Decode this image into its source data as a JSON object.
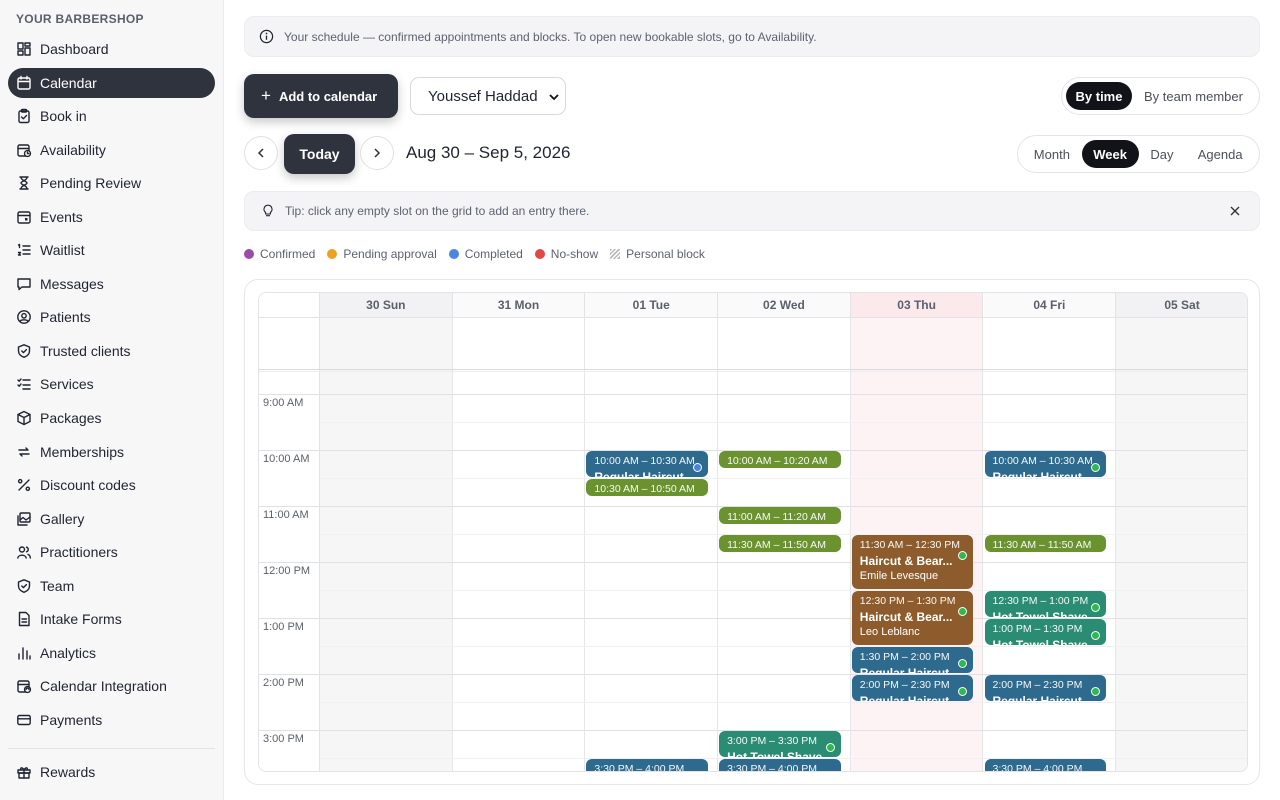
{
  "sidebar": {
    "brand": "YOUR BARBERSHOP",
    "items": [
      {
        "label": "Dashboard",
        "icon": "dashboard-icon"
      },
      {
        "label": "Calendar",
        "icon": "calendar-icon"
      },
      {
        "label": "Book in",
        "icon": "clipboard-icon"
      },
      {
        "label": "Availability",
        "icon": "calendar-clock-icon"
      },
      {
        "label": "Pending Review",
        "icon": "hourglass-icon"
      },
      {
        "label": "Events",
        "icon": "calendar-event-icon"
      },
      {
        "label": "Waitlist",
        "icon": "list-ordered-icon"
      },
      {
        "label": "Messages",
        "icon": "message-icon"
      },
      {
        "label": "Patients",
        "icon": "user-circle-icon"
      },
      {
        "label": "Trusted clients",
        "icon": "shield-check-icon"
      },
      {
        "label": "Services",
        "icon": "checklist-icon"
      },
      {
        "label": "Packages",
        "icon": "package-icon"
      },
      {
        "label": "Memberships",
        "icon": "repeat-icon"
      },
      {
        "label": "Discount codes",
        "icon": "percent-icon"
      },
      {
        "label": "Gallery",
        "icon": "gallery-icon"
      },
      {
        "label": "Practitioners",
        "icon": "users-icon"
      },
      {
        "label": "Team",
        "icon": "shield-icon"
      },
      {
        "label": "Intake Forms",
        "icon": "document-icon"
      },
      {
        "label": "Analytics",
        "icon": "bar-chart-icon"
      },
      {
        "label": "Calendar Integration",
        "icon": "calendar-sync-icon"
      },
      {
        "label": "Payments",
        "icon": "credit-card-icon"
      }
    ],
    "active_index": 1,
    "bottom_items": [
      {
        "label": "Rewards",
        "icon": "gift-icon"
      }
    ]
  },
  "banner": {
    "text": "Your schedule — confirmed appointments and blocks. To open new bookable slots, go to Availability."
  },
  "toolbar": {
    "add_label": "Add to calendar",
    "member_select": "Youssef Haddad",
    "view_mode": [
      "By time",
      "By team member"
    ],
    "view_mode_selected": "By time",
    "today_label": "Today",
    "date_range": "Aug 30 – Sep 5, 2026",
    "range_modes": [
      "Month",
      "Week",
      "Day",
      "Agenda"
    ],
    "range_mode_selected": "Week"
  },
  "tip": {
    "text": "Tip: click any empty slot on the grid to add an entry there."
  },
  "legend": [
    {
      "label": "Confirmed",
      "color": "#9b4ba8",
      "kind": "dot"
    },
    {
      "label": "Pending approval",
      "color": "#f0a020",
      "kind": "dot"
    },
    {
      "label": "Completed",
      "color": "#4a86e0",
      "kind": "dot"
    },
    {
      "label": "No-show",
      "color": "#e04848",
      "kind": "dot"
    },
    {
      "label": "Personal block",
      "color": "#b8b8be",
      "kind": "hatch"
    }
  ],
  "calendar": {
    "days": [
      "30 Sun",
      "31 Mon",
      "01 Tue",
      "02 Wed",
      "03 Thu",
      "04 Fri",
      "05 Sat"
    ],
    "today_index": 4,
    "times": [
      "9:00 AM",
      "10:00 AM",
      "11:00 AM",
      "12:00 PM",
      "1:00 PM",
      "2:00 PM",
      "3:00 PM"
    ],
    "colors": {
      "blue": "#2d6a8e",
      "olive": "#6a922e",
      "brown": "#8e5c2c",
      "teal": "#2b8c74"
    },
    "events": [
      {
        "day": 2,
        "start": 10.0,
        "end": 10.5,
        "time": "10:00 AM – 10:30 AM",
        "title": "Regular Haircut",
        "client": "",
        "color": "blue",
        "status": "#4a86e0"
      },
      {
        "day": 2,
        "start": 10.5,
        "end": 10.8333,
        "time": "10:30 AM – 10:50 AM",
        "title": "",
        "client": "",
        "color": "olive",
        "status": ""
      },
      {
        "day": 3,
        "start": 10.0,
        "end": 10.3333,
        "time": "10:00 AM – 10:20 AM",
        "title": "",
        "client": "",
        "color": "olive",
        "status": ""
      },
      {
        "day": 3,
        "start": 11.0,
        "end": 11.3333,
        "time": "11:00 AM – 11:20 AM",
        "title": "",
        "client": "",
        "color": "olive",
        "status": ""
      },
      {
        "day": 3,
        "start": 11.5,
        "end": 11.8333,
        "time": "11:30 AM – 11:50 AM",
        "title": "",
        "client": "",
        "color": "olive",
        "status": ""
      },
      {
        "day": 4,
        "start": 11.5,
        "end": 12.5,
        "time": "11:30 AM – 12:30 PM",
        "title": "Haircut & Bear...",
        "client": "Emile Levesque",
        "color": "brown",
        "status": "#2fb84e"
      },
      {
        "day": 4,
        "start": 12.5,
        "end": 13.5,
        "time": "12:30 PM – 1:30 PM",
        "title": "Haircut & Bear...",
        "client": "Leo Leblanc",
        "color": "brown",
        "status": "#2fb84e"
      },
      {
        "day": 4,
        "start": 13.5,
        "end": 14.0,
        "time": "1:30 PM – 2:00 PM",
        "title": "Regular Haircut",
        "client": "",
        "color": "blue",
        "status": "#2fb84e"
      },
      {
        "day": 4,
        "start": 14.0,
        "end": 14.5,
        "time": "2:00 PM – 2:30 PM",
        "title": "Regular Haircut",
        "client": "",
        "color": "blue",
        "status": "#2fb84e"
      },
      {
        "day": 5,
        "start": 10.0,
        "end": 10.5,
        "time": "10:00 AM – 10:30 AM",
        "title": "Regular Haircut",
        "client": "",
        "color": "blue",
        "status": "#2fb84e"
      },
      {
        "day": 5,
        "start": 11.5,
        "end": 11.8333,
        "time": "11:30 AM – 11:50 AM",
        "title": "",
        "client": "",
        "color": "olive",
        "status": ""
      },
      {
        "day": 5,
        "start": 12.5,
        "end": 13.0,
        "time": "12:30 PM – 1:00 PM",
        "title": "Hot Towel Shave",
        "client": "",
        "color": "teal",
        "status": "#2fb84e"
      },
      {
        "day": 5,
        "start": 13.0,
        "end": 13.5,
        "time": "1:00 PM – 1:30 PM",
        "title": "Hot Towel Shave",
        "client": "",
        "color": "teal",
        "status": "#2fb84e"
      },
      {
        "day": 5,
        "start": 14.0,
        "end": 14.5,
        "time": "2:00 PM – 2:30 PM",
        "title": "Regular Haircut",
        "client": "",
        "color": "blue",
        "status": "#2fb84e"
      },
      {
        "day": 3,
        "start": 15.0,
        "end": 15.5,
        "time": "3:00 PM – 3:30 PM",
        "title": "Hot Towel Shave",
        "client": "",
        "color": "teal",
        "status": "#2fb84e"
      },
      {
        "day": 2,
        "start": 15.5,
        "end": 16.0,
        "time": "3:30 PM – 4:00 PM",
        "title": "",
        "client": "",
        "color": "blue",
        "status": ""
      },
      {
        "day": 3,
        "start": 15.5,
        "end": 16.0,
        "time": "3:30 PM – 4:00 PM",
        "title": "",
        "client": "",
        "color": "blue",
        "status": ""
      },
      {
        "day": 5,
        "start": 15.5,
        "end": 16.0,
        "time": "3:30 PM – 4:00 PM",
        "title": "",
        "client": "",
        "color": "blue",
        "status": ""
      }
    ]
  }
}
